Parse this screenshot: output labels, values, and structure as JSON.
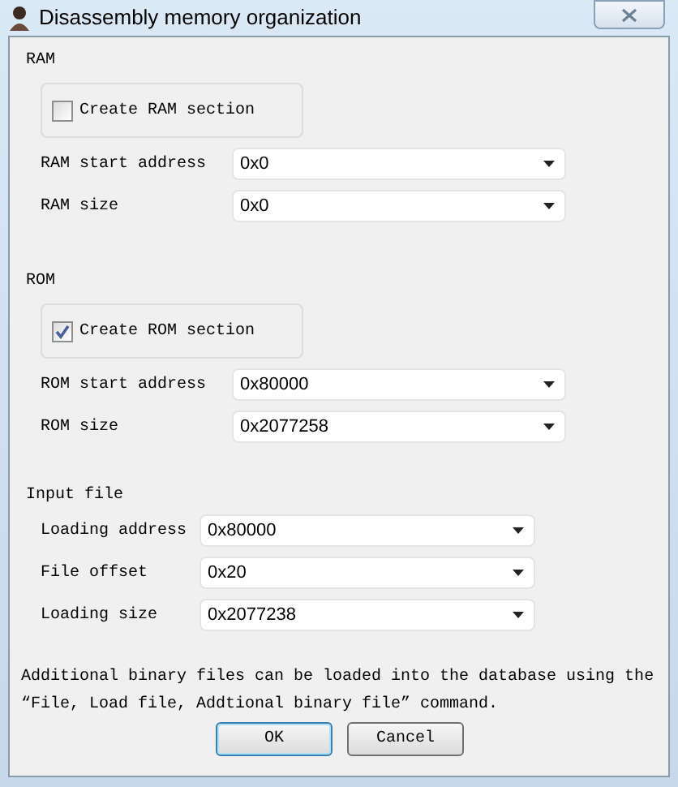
{
  "window": {
    "title": "Disassembly memory organization"
  },
  "sections": [
    {
      "title": "RAM",
      "checkbox": {
        "label": "Create RAM section",
        "checked": false
      },
      "fields": [
        {
          "label": "RAM start address",
          "value": "0x0"
        },
        {
          "label": "RAM size",
          "value": "0x0"
        }
      ]
    },
    {
      "title": "ROM",
      "checkbox": {
        "label": "Create ROM section",
        "checked": true
      },
      "fields": [
        {
          "label": "ROM start address",
          "value": "0x80000"
        },
        {
          "label": "ROM size",
          "value": "0x2077258"
        }
      ]
    },
    {
      "title": "Input file",
      "fields": [
        {
          "label": "Loading address",
          "value": "0x80000"
        },
        {
          "label": "File offset",
          "value": "0x20"
        },
        {
          "label": "Loading size",
          "value": "0x2077238"
        }
      ]
    }
  ],
  "note_lines": [
    "Additional binary files can be loaded into the database using the",
    "“File, Load file, Addtional binary file” command."
  ],
  "buttons": [
    {
      "label": "OK",
      "default": true
    },
    {
      "label": "Cancel",
      "default": false
    }
  ]
}
